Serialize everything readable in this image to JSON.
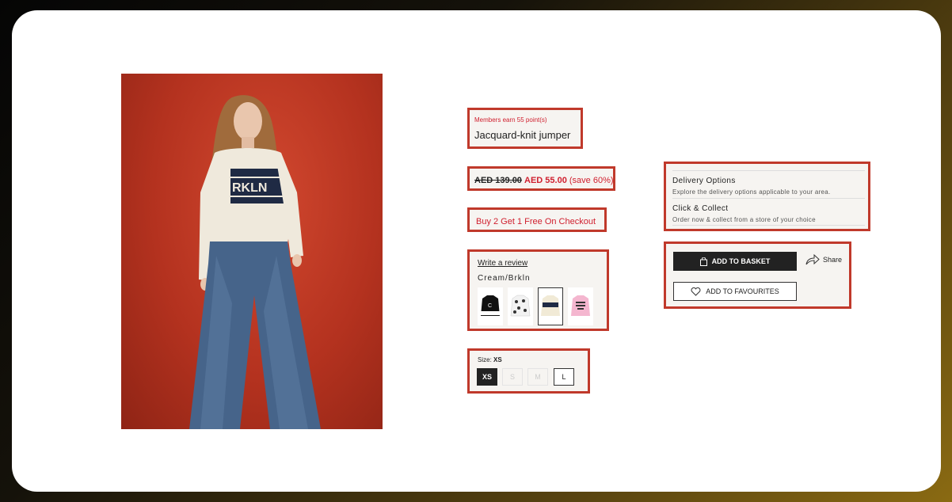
{
  "product": {
    "members_note": "Members earn 55 point(s)",
    "title": "Jacquard-knit jumper",
    "price_old": "AED 139.00",
    "price_new": "AED 55.00",
    "price_save": "(save 60%)",
    "promo": "Buy 2 Get 1 Free On Checkout",
    "review_link": "Write a review",
    "colour_name": "Cream/Brkln",
    "swatches": [
      "black-jumper",
      "white-patterned-jumper",
      "cream-brkln-jumper",
      "pink-jumper"
    ],
    "size_label": "Size:",
    "size_selected": "XS",
    "sizes": [
      "XS",
      "S",
      "M",
      "L"
    ]
  },
  "delivery": {
    "option1_title": "Delivery Options",
    "option1_sub": "Explore the delivery options applicable to your area.",
    "option2_title": "Click & Collect",
    "option2_sub": "Order now & collect from a store of your choice"
  },
  "actions": {
    "add_basket": "ADD TO BASKET",
    "add_favourites": "ADD TO FAVOURITES",
    "share": "Share"
  },
  "colors": {
    "accent": "#c0392b",
    "sale": "#d0202f",
    "photo_bg": "#b4321f"
  }
}
